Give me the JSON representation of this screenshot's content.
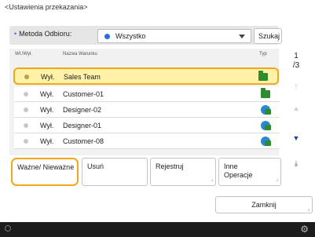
{
  "title": "<Ustawienia przekazania>",
  "method": {
    "label": "Metoda Odbioru:",
    "selected": "Wszystko",
    "search_label": "Szukaj"
  },
  "list": {
    "columns": [
      "Wł./Wył.",
      "Nazwa Warunku",
      "Typ"
    ],
    "rows": [
      {
        "kind": "Wył.",
        "name": "Sales Team",
        "type_icon": "folder-icon",
        "selected": true
      },
      {
        "kind": "Wył.",
        "name": "Customer-01",
        "type_icon": "folder-icon",
        "selected": false
      },
      {
        "kind": "Wył.",
        "name": "Designer-02",
        "type_icon": "globe-folder-icon",
        "selected": false
      },
      {
        "kind": "Wył.",
        "name": "Designer-01",
        "type_icon": "globe-folder-icon",
        "selected": false
      },
      {
        "kind": "Wył.",
        "name": "Customer-08",
        "type_icon": "globe-folder-icon",
        "selected": false
      }
    ]
  },
  "pager": {
    "current": "1",
    "total": "/3"
  },
  "actions": {
    "toggle": "Ważne/ Nieważne",
    "delete": "Usuń",
    "register": "Rejestruj",
    "other": "Inne Operacje"
  },
  "close_label": "Zamknij",
  "colors": {
    "highlight_border": "#f0a81b",
    "selected_row_bg": "#fff2a8",
    "accent_blue": "#2b6fd6",
    "status_bar": "#1c1c1c"
  }
}
